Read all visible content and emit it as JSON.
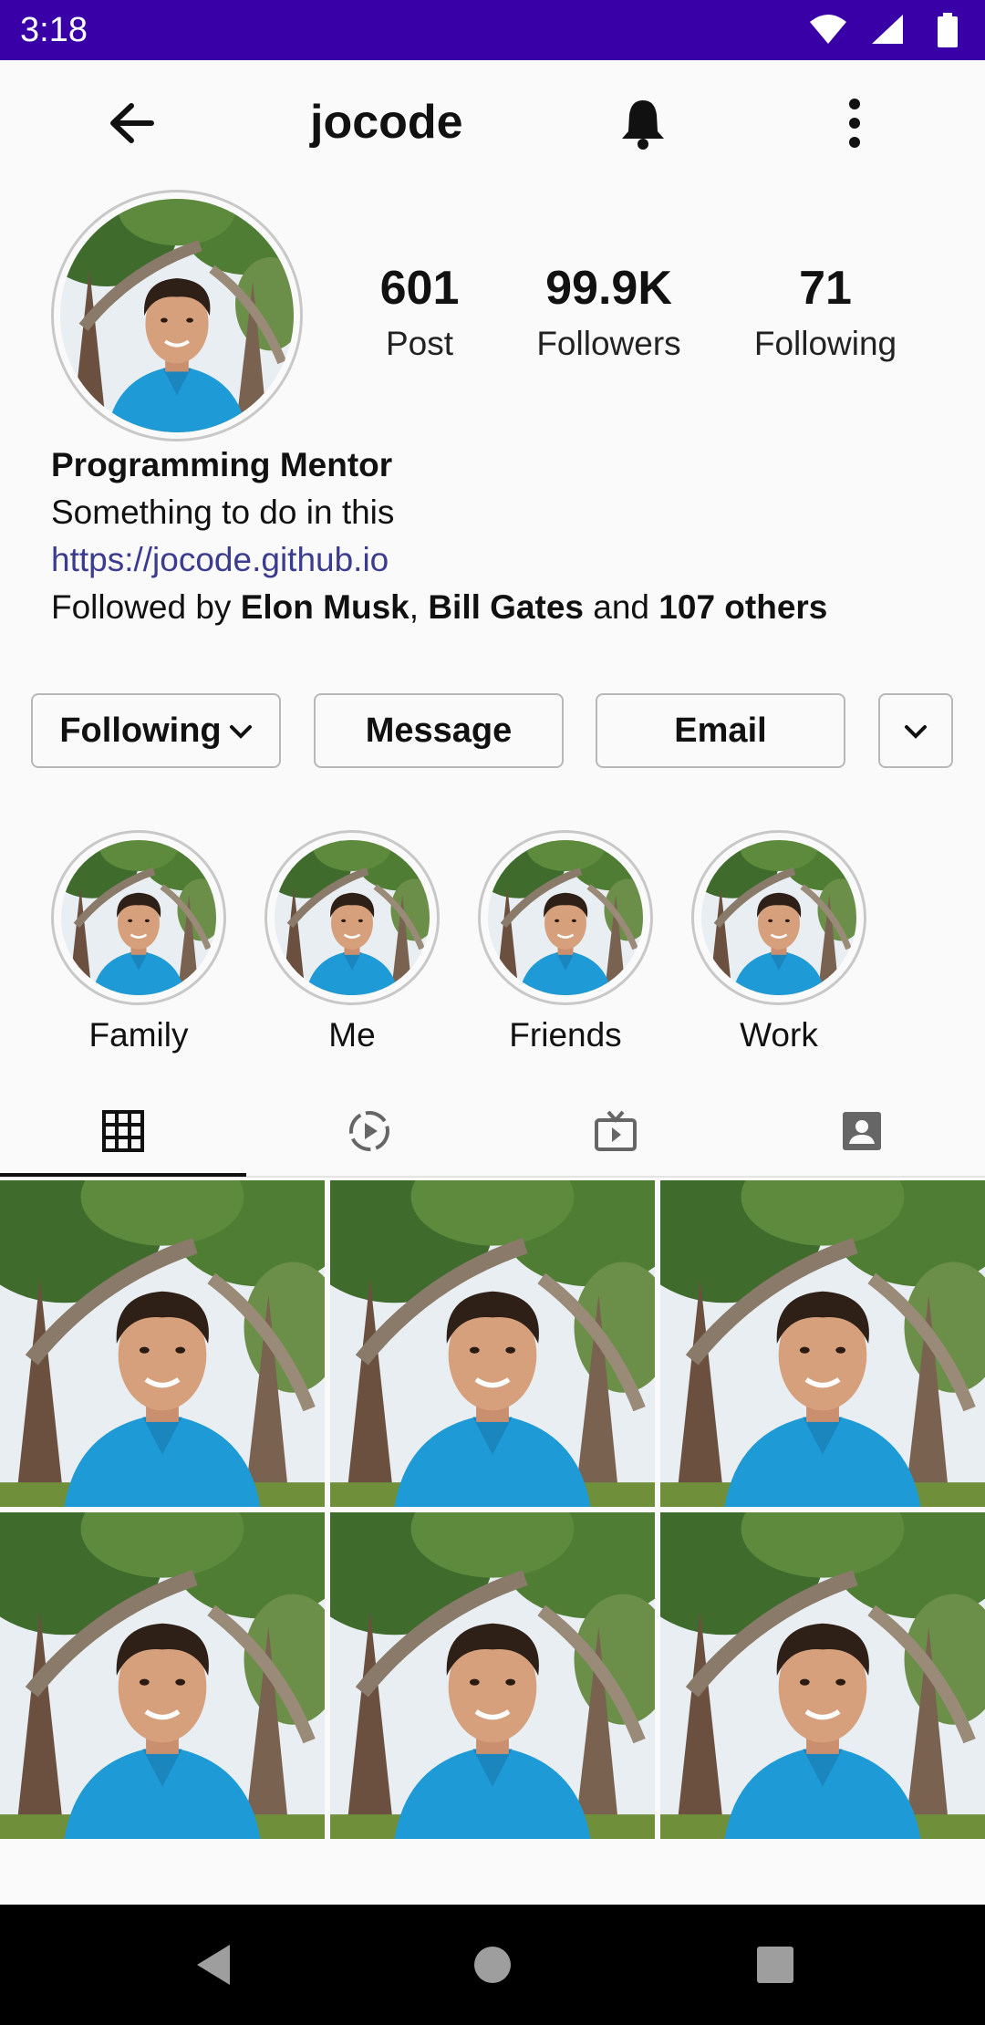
{
  "status_bar": {
    "time": "3:18",
    "background": "#3a00a8",
    "icons": [
      "wifi-icon",
      "cellular-signal-icon",
      "battery-icon"
    ]
  },
  "top_bar": {
    "username": "jocode",
    "icons": [
      "back-arrow-icon",
      "bell-icon",
      "more-vert-icon"
    ]
  },
  "stats": [
    {
      "value": "601",
      "label": "Post"
    },
    {
      "value": "99.9K",
      "label": "Followers"
    },
    {
      "value": "71",
      "label": "Following"
    }
  ],
  "bio": {
    "name": "Programming Mentor",
    "text": "Something to do in this",
    "link": "https://jocode.github.io",
    "followed_prefix": "Followed by ",
    "followed_user_1": "Elon Musk",
    "followed_sep": ", ",
    "followed_user_2": "Bill Gates",
    "followed_and": " and ",
    "followed_others": "107 others",
    "link_color": "#3b3b8f"
  },
  "actions": {
    "following": "Following",
    "message": "Message",
    "email": "Email"
  },
  "highlights": [
    {
      "label": "Family"
    },
    {
      "label": "Me"
    },
    {
      "label": "Friends"
    },
    {
      "label": "Work"
    }
  ],
  "tabs": [
    {
      "icon": "grid-icon",
      "selected": true
    },
    {
      "icon": "reels-icon",
      "selected": false
    },
    {
      "icon": "igtv-icon",
      "selected": false
    },
    {
      "icon": "tagged-icon",
      "selected": false
    }
  ],
  "nav_bar": {
    "icons": [
      "back-triangle-icon",
      "home-circle-icon",
      "recents-square-icon"
    ]
  }
}
